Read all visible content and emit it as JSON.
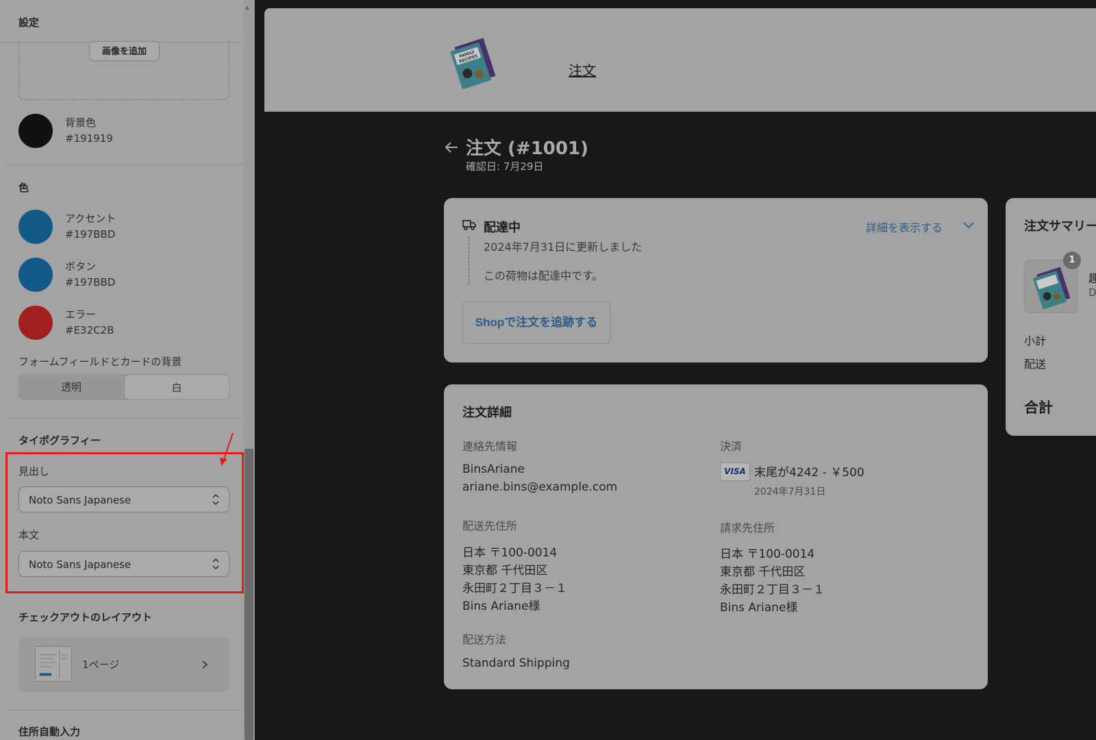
{
  "sidebar": {
    "title": "設定",
    "add_image_button": "画像を追加",
    "background_color": {
      "name": "背景色",
      "hex": "#191919"
    },
    "colors_heading": "色",
    "colors": [
      {
        "name": "アクセント",
        "hex": "#197BBD"
      },
      {
        "name": "ボタン",
        "hex": "#197BBD"
      },
      {
        "name": "エラー",
        "hex": "#E32C2B"
      }
    ],
    "form_bg_label": "フォームフィールドとカードの背景",
    "form_bg_options": [
      "透明",
      "白"
    ],
    "form_bg_selected": "白",
    "typography_heading": "タイポグラフィー",
    "heading_label": "見出し",
    "heading_font": "Noto Sans Japanese",
    "body_label": "本文",
    "body_font": "Noto Sans Japanese",
    "layout_heading": "チェックアウトのレイアウト",
    "layout_value": "1ページ",
    "autofill_heading": "住所自動入力"
  },
  "header": {
    "nav_link": "注文",
    "logo_icon": "family-favorite-recipes-book-logo"
  },
  "order": {
    "title": "注文 (#1001)",
    "confirmed": "確認日: 7月29日"
  },
  "status": {
    "title": "配達中",
    "show_details": "詳細を表示する",
    "updated": "2024年7月31日に更新しました",
    "message": "この荷物は配達中です。",
    "track_button": "Shopで注文を追跡する"
  },
  "details": {
    "title": "注文詳細",
    "contact_label": "連絡先情報",
    "contact_lines": [
      "BinsAriane",
      "ariane.bins@example.com"
    ],
    "payment_label": "決済",
    "card_brand": "VISA",
    "payment_line": "末尾が4242 - ￥500",
    "payment_date": "2024年7月31日",
    "shipping_label": "配送先住所",
    "shipping_lines": [
      "日本 〒100-0014",
      "東京都 千代田区",
      "永田町２丁目３－１",
      "Bins Ariane様"
    ],
    "billing_label": "請求先住所",
    "billing_lines": [
      "日本 〒100-0014",
      "東京都 千代田区",
      "永田町２丁目３－１",
      "Bins Ariane様"
    ],
    "method_label": "配送方法",
    "method_value": "Standard Shipping"
  },
  "summary": {
    "title": "注文サマリー",
    "quantity_badge": "1",
    "item_name_partial": "趣",
    "item_variant_partial": "D",
    "subtotal_label": "小計",
    "shipping_label": "配送",
    "total_label": "合計"
  },
  "colors": {
    "highlight": "#E21C1C",
    "link": "#2B5C8A"
  }
}
